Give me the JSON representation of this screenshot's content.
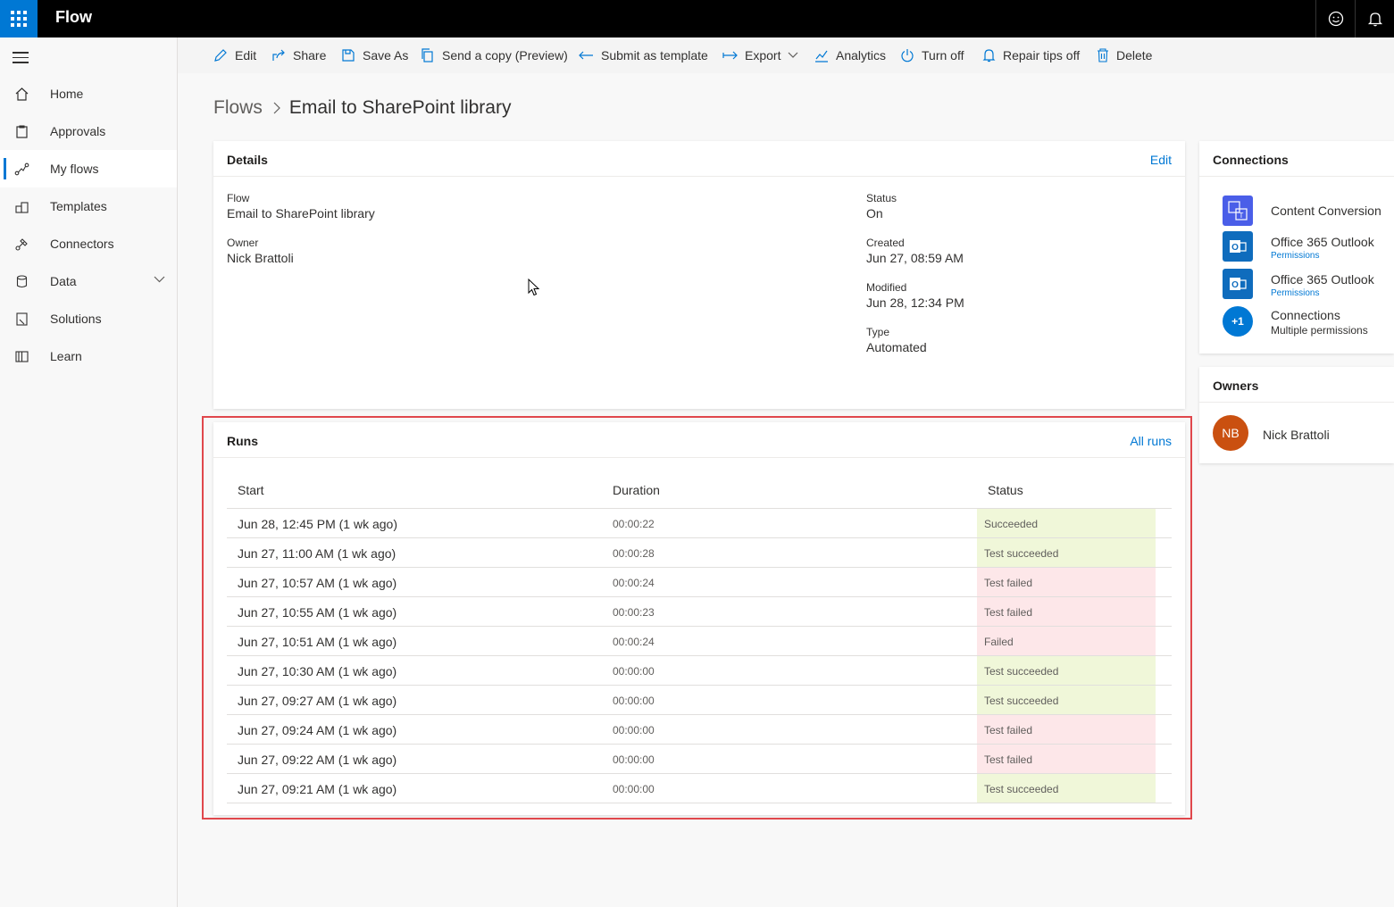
{
  "app": {
    "title": "Flow"
  },
  "sidebar": {
    "items": [
      {
        "label": "Home",
        "icon": "home-icon"
      },
      {
        "label": "Approvals",
        "icon": "approvals-icon"
      },
      {
        "label": "My flows",
        "icon": "my-flows-icon",
        "active": true
      },
      {
        "label": "Templates",
        "icon": "templates-icon"
      },
      {
        "label": "Connectors",
        "icon": "connectors-icon"
      },
      {
        "label": "Data",
        "icon": "data-icon",
        "expandable": true
      },
      {
        "label": "Solutions",
        "icon": "solutions-icon"
      },
      {
        "label": "Learn",
        "icon": "learn-icon"
      }
    ]
  },
  "toolbar": {
    "edit": "Edit",
    "share": "Share",
    "save_as": "Save As",
    "send_copy": "Send a copy (Preview)",
    "submit_template": "Submit as template",
    "export": "Export",
    "analytics": "Analytics",
    "turn_off": "Turn off",
    "repair_tips": "Repair tips off",
    "delete": "Delete"
  },
  "breadcrumb": {
    "root": "Flows",
    "current": "Email to SharePoint library"
  },
  "details": {
    "title": "Details",
    "edit_link": "Edit",
    "flow_label": "Flow",
    "flow_value": "Email to SharePoint library",
    "owner_label": "Owner",
    "owner_value": "Nick Brattoli",
    "status_label": "Status",
    "status_value": "On",
    "created_label": "Created",
    "created_value": "Jun 27, 08:59 AM",
    "modified_label": "Modified",
    "modified_value": "Jun 28, 12:34 PM",
    "type_label": "Type",
    "type_value": "Automated"
  },
  "runs": {
    "title": "Runs",
    "all_runs_link": "All runs",
    "columns": {
      "start": "Start",
      "duration": "Duration",
      "status": "Status"
    },
    "rows": [
      {
        "start": "Jun 28, 12:45 PM (1 wk ago)",
        "duration": "00:00:22",
        "status": "Succeeded",
        "ok": true
      },
      {
        "start": "Jun 27, 11:00 AM (1 wk ago)",
        "duration": "00:00:28",
        "status": "Test succeeded",
        "ok": true
      },
      {
        "start": "Jun 27, 10:57 AM (1 wk ago)",
        "duration": "00:00:24",
        "status": "Test failed",
        "ok": false
      },
      {
        "start": "Jun 27, 10:55 AM (1 wk ago)",
        "duration": "00:00:23",
        "status": "Test failed",
        "ok": false
      },
      {
        "start": "Jun 27, 10:51 AM (1 wk ago)",
        "duration": "00:00:24",
        "status": "Failed",
        "ok": false
      },
      {
        "start": "Jun 27, 10:30 AM (1 wk ago)",
        "duration": "00:00:00",
        "status": "Test succeeded",
        "ok": true
      },
      {
        "start": "Jun 27, 09:27 AM (1 wk ago)",
        "duration": "00:00:00",
        "status": "Test succeeded",
        "ok": true
      },
      {
        "start": "Jun 27, 09:24 AM (1 wk ago)",
        "duration": "00:00:00",
        "status": "Test failed",
        "ok": false
      },
      {
        "start": "Jun 27, 09:22 AM (1 wk ago)",
        "duration": "00:00:00",
        "status": "Test failed",
        "ok": false
      },
      {
        "start": "Jun 27, 09:21 AM (1 wk ago)",
        "duration": "00:00:00",
        "status": "Test succeeded",
        "ok": true
      }
    ]
  },
  "connections": {
    "title": "Connections",
    "items": [
      {
        "name": "Content Conversion",
        "sub": ""
      },
      {
        "name": "Office 365 Outlook",
        "sub": "Permissions"
      },
      {
        "name": "Office 365 Outlook",
        "sub": "Permissions"
      },
      {
        "name": "Connections",
        "sub": "Multiple permissions",
        "badge": "+1"
      }
    ]
  },
  "owners": {
    "title": "Owners",
    "items": [
      {
        "initials": "NB",
        "name": "Nick Brattoli"
      }
    ]
  },
  "colors": {
    "accent": "#0078d4",
    "success_bg": "#f0f7d9",
    "failure_bg": "#fde7e9",
    "highlight_border": "#e0474c",
    "avatar": "#ca5010"
  }
}
